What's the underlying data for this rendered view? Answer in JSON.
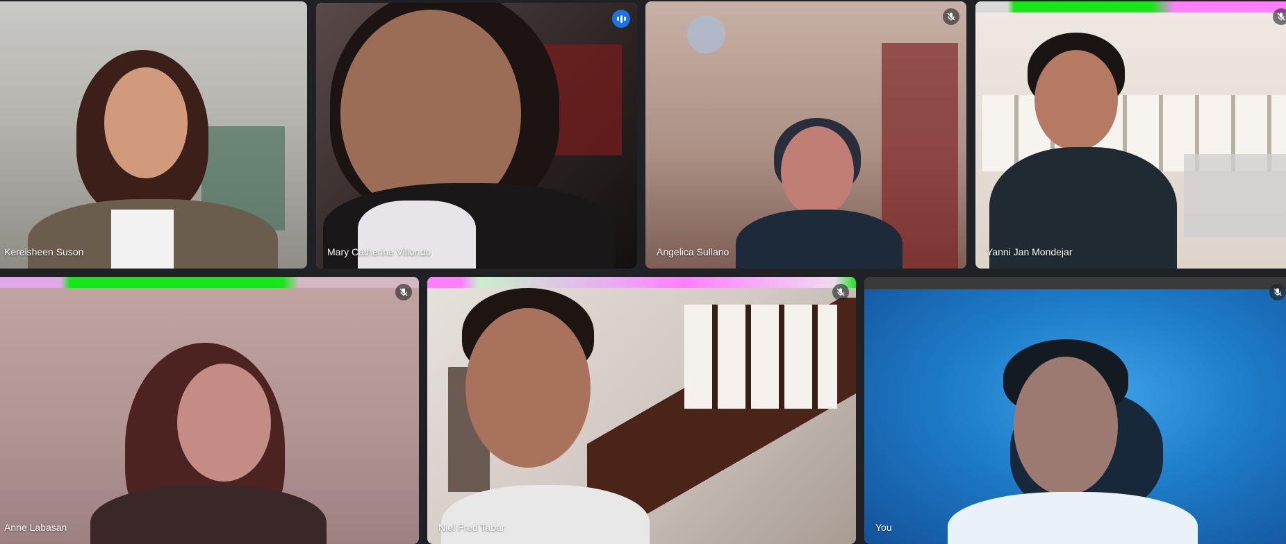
{
  "participants": [
    {
      "name": "Kereisheen Suson",
      "muted": false,
      "speaking": false
    },
    {
      "name": "Mary Catherine Villondo",
      "muted": false,
      "speaking": true
    },
    {
      "name": "Angelica Sullano",
      "muted": true,
      "speaking": false
    },
    {
      "name": "Yanni Jan Mondejar",
      "muted": true,
      "speaking": false
    },
    {
      "name": "Anne Labasan",
      "muted": true,
      "speaking": false
    },
    {
      "name": "Niel Fred Tabar",
      "muted": true,
      "speaking": false
    },
    {
      "name": "You",
      "muted": true,
      "speaking": false
    }
  ],
  "icons": {
    "muted": "mic-off-icon",
    "speaking": "audio-level-icon"
  },
  "colors": {
    "background": "#202124",
    "active_border": "#7aa7f0",
    "speaking_badge": "#1a73e8"
  }
}
